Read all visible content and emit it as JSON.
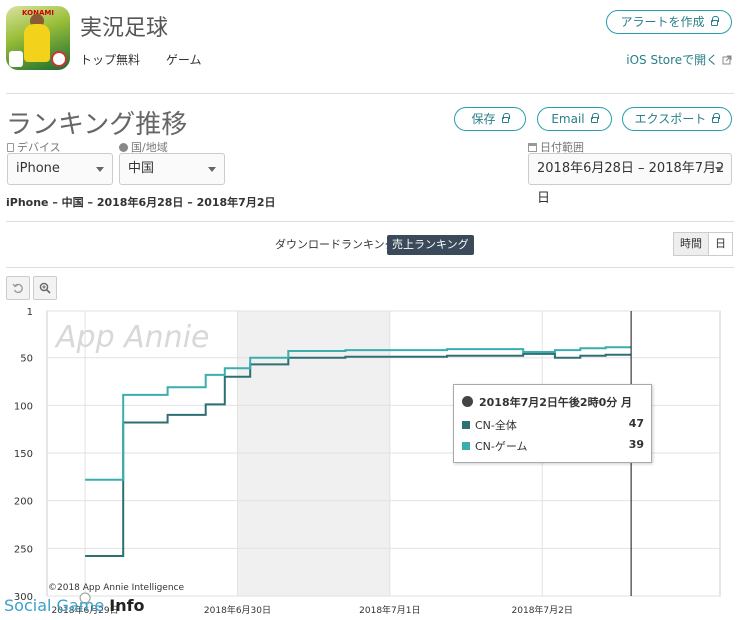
{
  "app": {
    "title": "実況足球",
    "icon_brand": "KONAMI",
    "categories": [
      "トップ無料",
      "ゲーム"
    ],
    "alert_button": "アラートを作成",
    "store_link": "iOS Storeで開く"
  },
  "section": {
    "title": "ランキング推移",
    "buttons": {
      "save": "保存",
      "email": "Email",
      "export": "エクスポート"
    }
  },
  "filters": {
    "device_label": "デバイス",
    "device_value": "iPhone",
    "country_label": "国/地域",
    "country_value": "中国",
    "date_label": "日付範囲",
    "date_value": "2018年6月28日 – 2018年7月2日"
  },
  "summary": "iPhone – 中国 – 2018年6月28日 – 2018年7月2日",
  "tabs": {
    "download": "ダウンロードランキング",
    "revenue": "売上ランキング"
  },
  "granularity": {
    "hour": "時間",
    "day": "日"
  },
  "tools": {
    "reset_icon": "undo-icon",
    "zoom_icon": "zoom-icon"
  },
  "watermark": "App Annie",
  "copyright": "©2018 App Annie Intelligence",
  "site_watermark": {
    "part1": "Social Game",
    "part2": "Info"
  },
  "tooltip": {
    "title": "2018年7月2日午後2時0分 月",
    "rows": [
      {
        "name": "CN-全体",
        "value": "47",
        "color": "#2e6f72"
      },
      {
        "name": "CN-ゲーム",
        "value": "39",
        "color": "#3aaeae"
      }
    ]
  },
  "chart_data": {
    "type": "line",
    "x_unit": "hours since 2018-06-28 18:00",
    "xlim": [
      0,
      106
    ],
    "ylim": [
      1,
      300
    ],
    "y_inverted": true,
    "yticks": [
      1,
      50,
      100,
      150,
      200,
      250,
      300
    ],
    "xticks": [
      {
        "x": 6,
        "label": "2018年6月29日"
      },
      {
        "x": 30,
        "label": "2018年6月30日"
      },
      {
        "x": 54,
        "label": "2018年7月1日"
      },
      {
        "x": 78,
        "label": "2018年7月2日"
      }
    ],
    "shaded_band": [
      30,
      54
    ],
    "cursor_x": 92,
    "series": [
      {
        "name": "CN-全体",
        "color": "#2e6f72",
        "points": [
          [
            6,
            258
          ],
          [
            12,
            258
          ],
          [
            12,
            118
          ],
          [
            19,
            118
          ],
          [
            19,
            110
          ],
          [
            25,
            110
          ],
          [
            25,
            99
          ],
          [
            28,
            99
          ],
          [
            28,
            70
          ],
          [
            32,
            70
          ],
          [
            32,
            57
          ],
          [
            38,
            57
          ],
          [
            38,
            50
          ],
          [
            47,
            50
          ],
          [
            47,
            49
          ],
          [
            63,
            49
          ],
          [
            63,
            48
          ],
          [
            75,
            48
          ],
          [
            75,
            46
          ],
          [
            80,
            46
          ],
          [
            80,
            50
          ],
          [
            84,
            50
          ],
          [
            84,
            48
          ],
          [
            88,
            48
          ],
          [
            88,
            47
          ],
          [
            92,
            47
          ]
        ]
      },
      {
        "name": "CN-ゲーム",
        "color": "#3aaeae",
        "points": [
          [
            6,
            178
          ],
          [
            12,
            178
          ],
          [
            12,
            89
          ],
          [
            19,
            89
          ],
          [
            19,
            81
          ],
          [
            25,
            81
          ],
          [
            25,
            68
          ],
          [
            28,
            68
          ],
          [
            28,
            61
          ],
          [
            32,
            61
          ],
          [
            32,
            50
          ],
          [
            38,
            50
          ],
          [
            38,
            43
          ],
          [
            47,
            43
          ],
          [
            47,
            42
          ],
          [
            63,
            42
          ],
          [
            63,
            41
          ],
          [
            75,
            41
          ],
          [
            75,
            44
          ],
          [
            80,
            44
          ],
          [
            80,
            42
          ],
          [
            84,
            42
          ],
          [
            84,
            40
          ],
          [
            88,
            40
          ],
          [
            88,
            39
          ],
          [
            92,
            39
          ]
        ]
      }
    ]
  }
}
